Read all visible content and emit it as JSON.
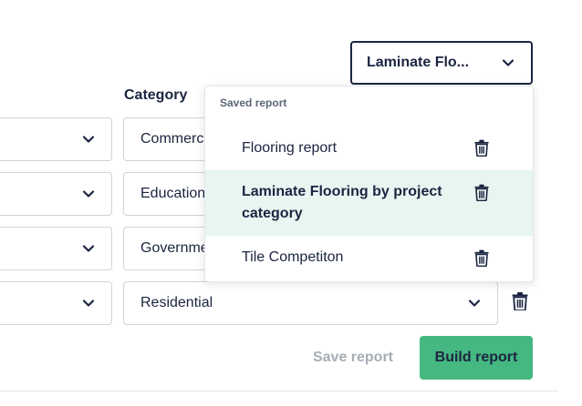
{
  "saved_select": {
    "value": "Laminate Flo...",
    "icon": "chevron-down-icon"
  },
  "table": {
    "category_header": "Category",
    "rows": [
      {
        "category": "Commercial"
      },
      {
        "category": "Education"
      },
      {
        "category": "Government"
      },
      {
        "category": "Residential"
      }
    ]
  },
  "dropdown": {
    "heading": "Saved report",
    "items": [
      {
        "label": "Flooring report",
        "active": false
      },
      {
        "label": "Laminate Flooring by project category",
        "active": true
      },
      {
        "label": "Tile Competiton",
        "active": false
      }
    ]
  },
  "actions": {
    "save_label": "Save report",
    "build_label": "Build report"
  },
  "colors": {
    "primary": "#45b882",
    "text": "#1b2540",
    "active_bg": "#e8f6f2",
    "muted": "#a7adb7"
  }
}
